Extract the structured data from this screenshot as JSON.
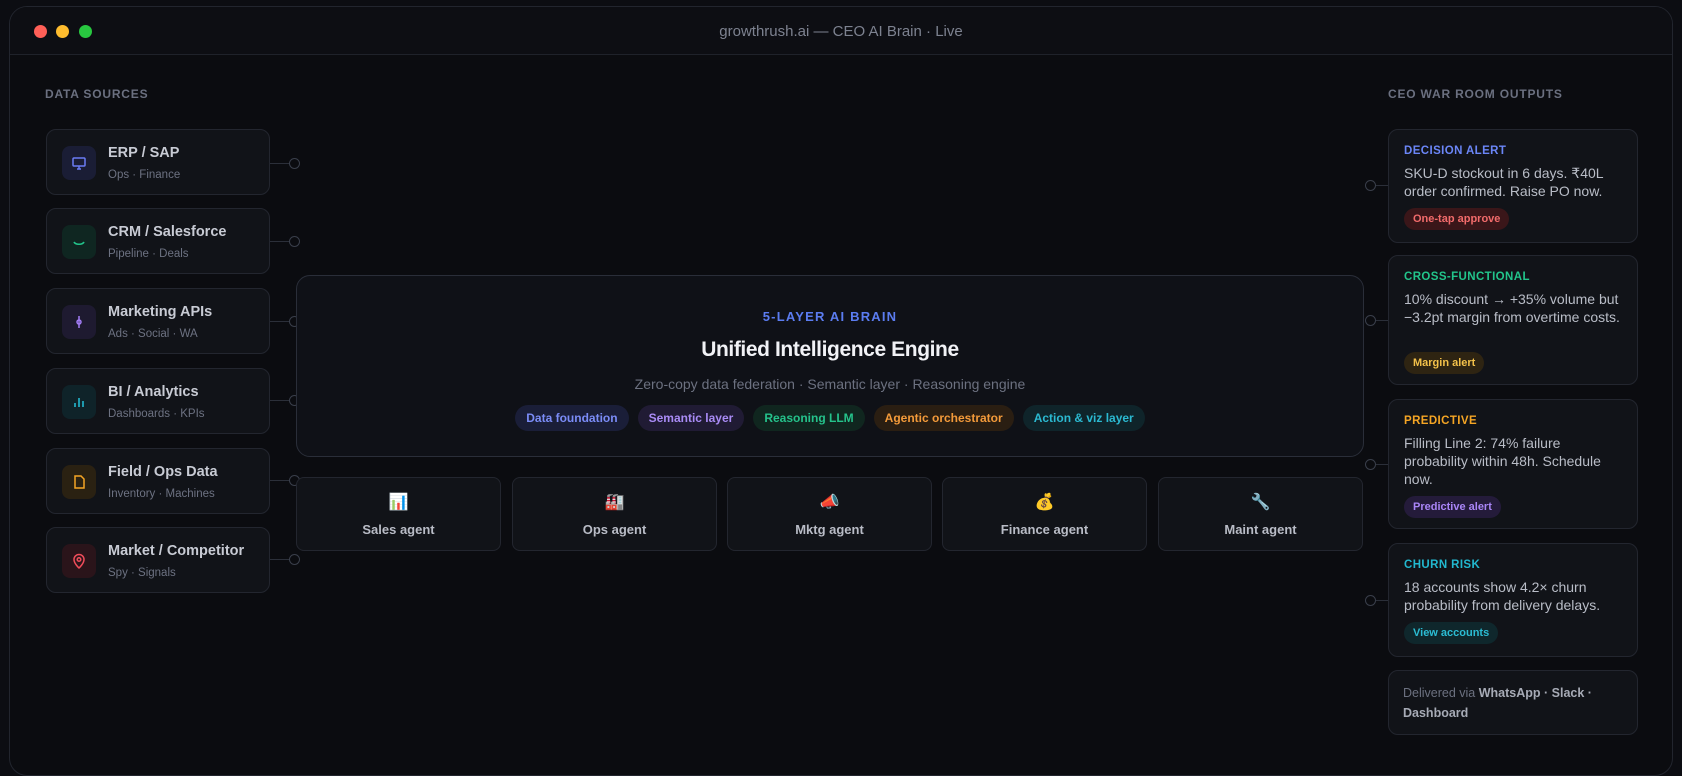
{
  "window": {
    "title": "growthrush.ai — CEO AI Brain · Live"
  },
  "sources": {
    "heading": "DATA SOURCES",
    "items": [
      {
        "name": "ERP / SAP",
        "sub": "Ops · Finance",
        "icon": "monitor-icon",
        "color": "#6b7cf5",
        "bg": "#1a1d35"
      },
      {
        "name": "CRM / Salesforce",
        "sub": "Pipeline · Deals",
        "icon": "smile-icon",
        "color": "#22c58b",
        "bg": "#0f2621"
      },
      {
        "name": "Marketing APIs",
        "sub": "Ads · Social · WA",
        "icon": "pen-icon",
        "color": "#a27cf5",
        "bg": "#1e1a30"
      },
      {
        "name": "BI / Analytics",
        "sub": "Dashboards · KPIs",
        "icon": "bar-chart-icon",
        "color": "#22b8cf",
        "bg": "#0f2329"
      },
      {
        "name": "Field / Ops Data",
        "sub": "Inventory · Machines",
        "icon": "file-icon",
        "color": "#f5a524",
        "bg": "#2a2112"
      },
      {
        "name": "Market / Competitor",
        "sub": "Spy · Signals",
        "icon": "map-pin-icon",
        "color": "#ef4c5a",
        "bg": "#2a141a"
      }
    ]
  },
  "engine": {
    "label": "5-LAYER AI BRAIN",
    "title": "Unified Intelligence Engine",
    "subtitle": "Zero-copy data federation · Semantic layer · Reasoning engine",
    "layers": [
      {
        "label": "Data foundation",
        "color": "#7b8cf7",
        "bg": "#1a1e38"
      },
      {
        "label": "Semantic layer",
        "color": "#a98bf5",
        "bg": "#201b34"
      },
      {
        "label": "Reasoning LLM",
        "color": "#25c28b",
        "bg": "#10261f"
      },
      {
        "label": "Agentic orchestrator",
        "color": "#f39a3a",
        "bg": "#2a1e12"
      },
      {
        "label": "Action & viz layer",
        "color": "#2bb9d1",
        "bg": "#0f242a"
      }
    ]
  },
  "agents": [
    {
      "name": "Sales agent",
      "icon": "📊",
      "icon_name": "chart-icon"
    },
    {
      "name": "Ops agent",
      "icon": "🏭",
      "icon_name": "factory-icon"
    },
    {
      "name": "Mktg agent",
      "icon": "📣",
      "icon_name": "megaphone-icon"
    },
    {
      "name": "Finance agent",
      "icon": "💰",
      "icon_name": "money-bag-icon"
    },
    {
      "name": "Maint agent",
      "icon": "🔧",
      "icon_name": "wrench-icon"
    }
  ],
  "outputs": {
    "heading": "CEO WAR ROOM OUTPUTS",
    "items": [
      {
        "label": "DECISION ALERT",
        "label_color": "#6b86f7",
        "text": "SKU-D stockout in 6 days. ₹40L order confirmed. Raise PO now.",
        "badge": "One-tap approve",
        "badge_color": "#f26b6b",
        "badge_bg": "#3a1619"
      },
      {
        "label": "CROSS-FUNCTIONAL",
        "label_color": "#22c58b",
        "text": "10% discount → +35% volume but −3.2pt margin from overtime costs.",
        "badge": "Margin alert",
        "badge_color": "#f3c14a",
        "badge_bg": "#2e2412"
      },
      {
        "label": "PREDICTIVE",
        "label_color": "#f5a524",
        "text": "Filling Line 2: 74% failure probability within 48h. Schedule now.",
        "badge": "Predictive alert",
        "badge_color": "#a985f7",
        "badge_bg": "#241b3a"
      },
      {
        "label": "CHURN RISK",
        "label_color": "#22b8cf",
        "text": "18 accounts show 4.2× churn probability from delivery delays.",
        "badge": "View accounts",
        "badge_color": "#2bbcd3",
        "badge_bg": "#0f272c"
      }
    ],
    "delivered_prefix": "Delivered via",
    "delivered_channels": "WhatsApp · Slack · Dashboard"
  }
}
